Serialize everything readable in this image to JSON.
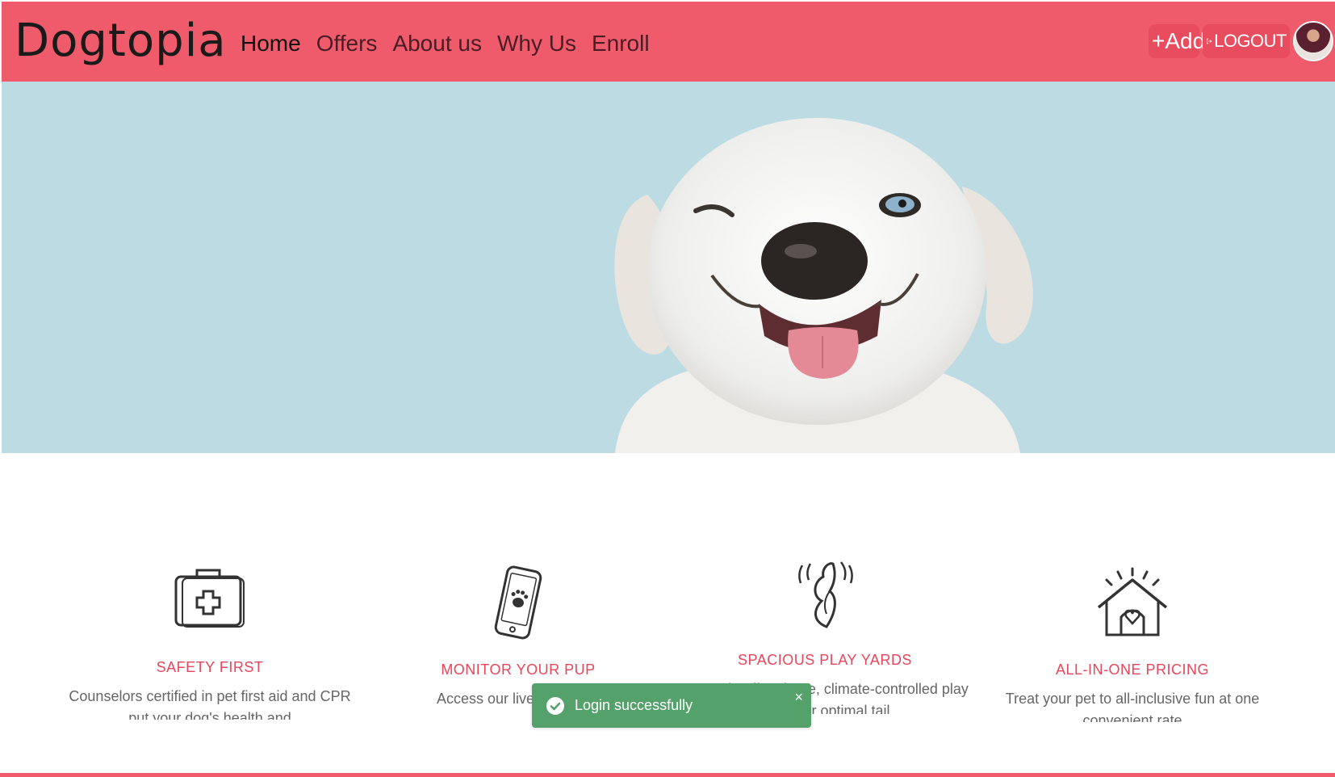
{
  "navbar": {
    "brand": "Dogtopia",
    "links": [
      "Home",
      "Offers",
      "About us",
      "Why Us",
      "Enroll"
    ],
    "add_label": "+Add",
    "logout_label": "LOGOUT",
    "colors": {
      "bar": "#ef5b6b",
      "button": "#e84d5f"
    }
  },
  "hero": {
    "image": "smiling-winking-white-puppy"
  },
  "features": [
    {
      "icon": "first-aid-kit-icon",
      "title": "SAFETY FIRST",
      "text": "Counselors certified in pet first aid and CPR put your dog's health and"
    },
    {
      "icon": "phone-paw-icon",
      "title": "MONITOR YOUR PUP",
      "text": "Access our live webcams"
    },
    {
      "icon": "wagging-tail-icon",
      "title": "SPACIOUS PLAY YARDS",
      "text": "Dogtopia offers large, climate-controlled play yards for optimal tail"
    },
    {
      "icon": "dog-house-heart-icon",
      "title": "ALL-IN-ONE PRICING",
      "text": "Treat your pet to all-inclusive fun at one convenient rate"
    }
  ],
  "toast": {
    "message": "Login successfully",
    "close": "×",
    "color": "#55a16b"
  }
}
